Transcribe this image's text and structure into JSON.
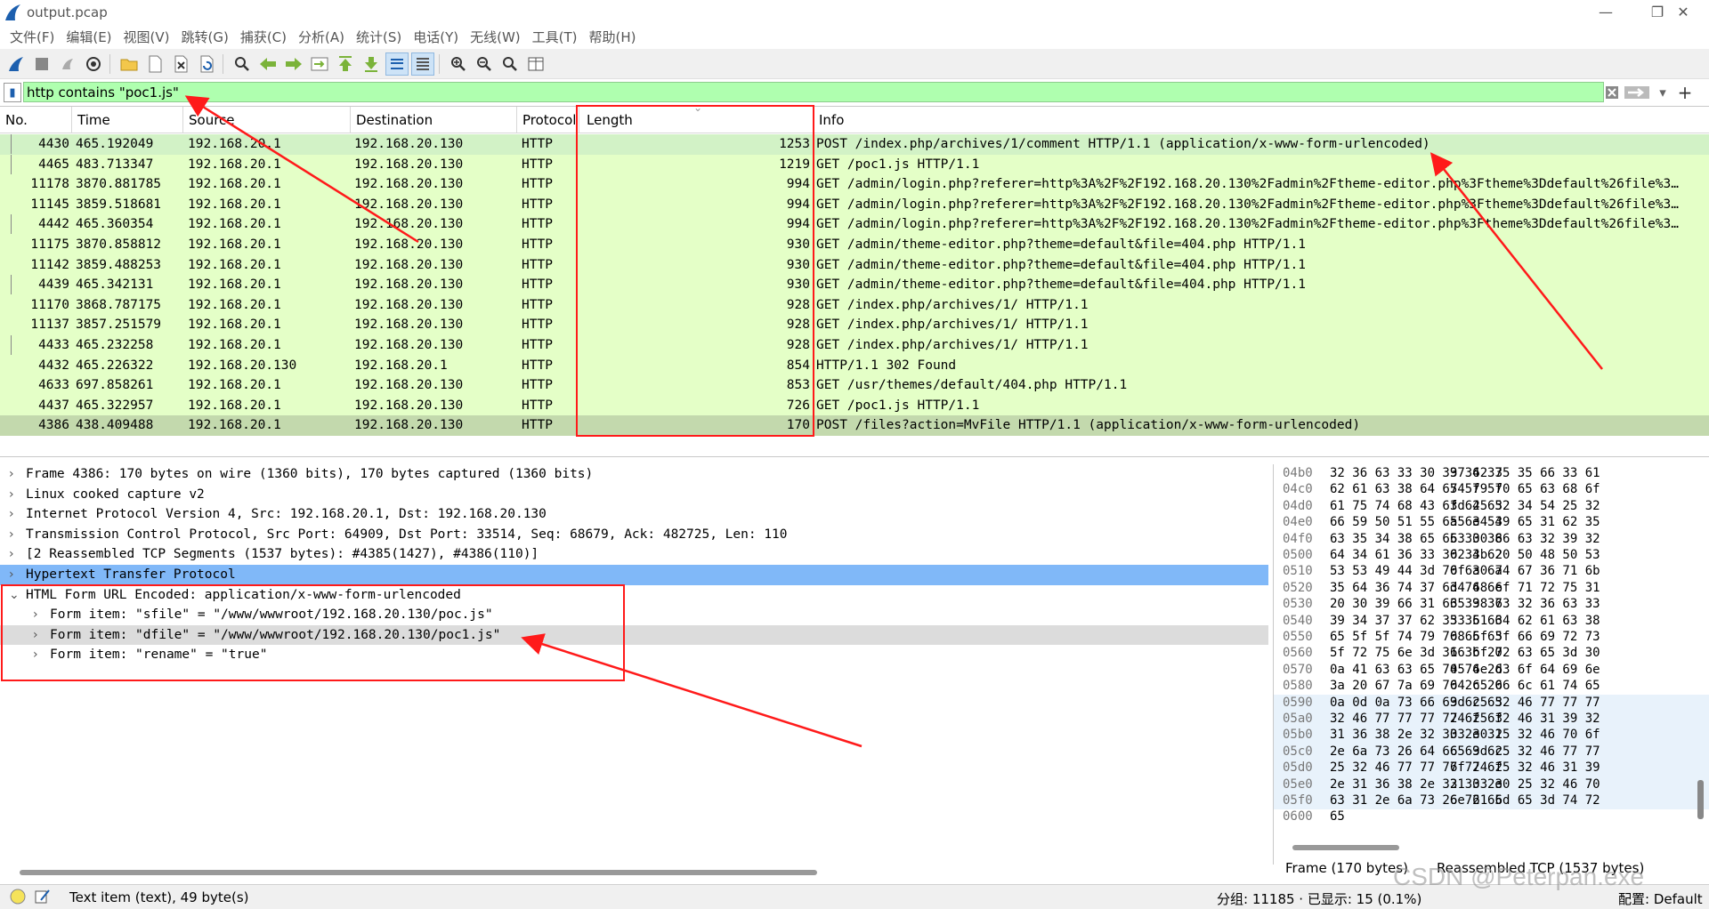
{
  "window": {
    "title": "output.pcap",
    "minimize": "—",
    "maximize": "❐",
    "close": "✕"
  },
  "menu": [
    "文件(F)",
    "编辑(E)",
    "视图(V)",
    "跳转(G)",
    "捕获(C)",
    "分析(A)",
    "统计(S)",
    "电话(Y)",
    "无线(W)",
    "工具(T)",
    "帮助(H)"
  ],
  "toolbar": {
    "icons": [
      "start-capture-icon",
      "stop-capture-icon",
      "restart-capture-icon",
      "capture-options-icon",
      "open-file-icon",
      "save-file-icon",
      "close-file-icon",
      "reload-file-icon",
      "find-packet-icon",
      "go-back-icon",
      "go-forward-icon",
      "go-to-packet-icon",
      "go-first-icon",
      "go-last-icon",
      "autoscroll-icon",
      "colorize-icon",
      "zoom-in-icon",
      "zoom-out-icon",
      "zoom-normal-icon",
      "resize-columns-icon"
    ]
  },
  "filter": {
    "value": "http contains \"poc1.js\"",
    "plus": "+"
  },
  "columns": {
    "no": "No.",
    "time": "Time",
    "source": "Source",
    "destination": "Destination",
    "protocol": "Protocol",
    "length": "Length",
    "info": "Info"
  },
  "packets": [
    {
      "no": "4430",
      "time": "465.192049",
      "src": "192.168.20.1",
      "dst": "192.168.20.130",
      "proto": "HTTP",
      "len": "1253",
      "info": "POST /index.php/archives/1/comment HTTP/1.1  (application/x-www-form-urlencoded)"
    },
    {
      "no": "4465",
      "time": "483.713347",
      "src": "192.168.20.1",
      "dst": "192.168.20.130",
      "proto": "HTTP",
      "len": "1219",
      "info": "GET /poc1.js HTTP/1.1"
    },
    {
      "no": "11178",
      "time": "3870.881785",
      "src": "192.168.20.1",
      "dst": "192.168.20.130",
      "proto": "HTTP",
      "len": "994",
      "info": "GET /admin/login.php?referer=http%3A%2F%2F192.168.20.130%2Fadmin%2Ftheme-editor.php%3Ftheme%3Ddefault%26file%3…"
    },
    {
      "no": "11145",
      "time": "3859.518681",
      "src": "192.168.20.1",
      "dst": "192.168.20.130",
      "proto": "HTTP",
      "len": "994",
      "info": "GET /admin/login.php?referer=http%3A%2F%2F192.168.20.130%2Fadmin%2Ftheme-editor.php%3Ftheme%3Ddefault%26file%3…"
    },
    {
      "no": "4442",
      "time": "465.360354",
      "src": "192.168.20.1",
      "dst": "192.168.20.130",
      "proto": "HTTP",
      "len": "994",
      "info": "GET /admin/login.php?referer=http%3A%2F%2F192.168.20.130%2Fadmin%2Ftheme-editor.php%3Ftheme%3Ddefault%26file%3…"
    },
    {
      "no": "11175",
      "time": "3870.858812",
      "src": "192.168.20.1",
      "dst": "192.168.20.130",
      "proto": "HTTP",
      "len": "930",
      "info": "GET /admin/theme-editor.php?theme=default&file=404.php HTTP/1.1"
    },
    {
      "no": "11142",
      "time": "3859.488253",
      "src": "192.168.20.1",
      "dst": "192.168.20.130",
      "proto": "HTTP",
      "len": "930",
      "info": "GET /admin/theme-editor.php?theme=default&file=404.php HTTP/1.1"
    },
    {
      "no": "4439",
      "time": "465.342131",
      "src": "192.168.20.1",
      "dst": "192.168.20.130",
      "proto": "HTTP",
      "len": "930",
      "info": "GET /admin/theme-editor.php?theme=default&file=404.php HTTP/1.1"
    },
    {
      "no": "11170",
      "time": "3868.787175",
      "src": "192.168.20.1",
      "dst": "192.168.20.130",
      "proto": "HTTP",
      "len": "928",
      "info": "GET /index.php/archives/1/ HTTP/1.1"
    },
    {
      "no": "11137",
      "time": "3857.251579",
      "src": "192.168.20.1",
      "dst": "192.168.20.130",
      "proto": "HTTP",
      "len": "928",
      "info": "GET /index.php/archives/1/ HTTP/1.1"
    },
    {
      "no": "4433",
      "time": "465.232258",
      "src": "192.168.20.1",
      "dst": "192.168.20.130",
      "proto": "HTTP",
      "len": "928",
      "info": "GET /index.php/archives/1/ HTTP/1.1"
    },
    {
      "no": "4432",
      "time": "465.226322",
      "src": "192.168.20.130",
      "dst": "192.168.20.1",
      "proto": "HTTP",
      "len": "854",
      "info": "HTTP/1.1 302 Found"
    },
    {
      "no": "4633",
      "time": "697.858261",
      "src": "192.168.20.1",
      "dst": "192.168.20.130",
      "proto": "HTTP",
      "len": "853",
      "info": "GET /usr/themes/default/404.php HTTP/1.1"
    },
    {
      "no": "4437",
      "time": "465.322957",
      "src": "192.168.20.1",
      "dst": "192.168.20.130",
      "proto": "HTTP",
      "len": "726",
      "info": "GET /poc1.js HTTP/1.1"
    },
    {
      "no": "4386",
      "time": "438.409488",
      "src": "192.168.20.1",
      "dst": "192.168.20.130",
      "proto": "HTTP",
      "len": "170",
      "info": "POST /files?action=MvFile HTTP/1.1  (application/x-www-form-urlencoded)"
    }
  ],
  "details": [
    {
      "arrow": "›",
      "text": "Frame 4386: 170 bytes on wire (1360 bits), 170 bytes captured (1360 bits)"
    },
    {
      "arrow": "›",
      "text": "Linux cooked capture v2"
    },
    {
      "arrow": "›",
      "text": "Internet Protocol Version 4, Src: 192.168.20.1, Dst: 192.168.20.130"
    },
    {
      "arrow": "›",
      "text": "Transmission Control Protocol, Src Port: 64909, Dst Port: 33514, Seq: 68679, Ack: 482725, Len: 110"
    },
    {
      "arrow": "›",
      "text": "[2 Reassembled TCP Segments (1537 bytes): #4385(1427), #4386(110)]"
    },
    {
      "arrow": "›",
      "text": "Hypertext Transfer Protocol"
    },
    {
      "arrow": "⌄",
      "text": "HTML Form URL Encoded: application/x-www-form-urlencoded"
    },
    {
      "arrow": "›",
      "text": "Form item: \"sfile\" = \"/www/wwwroot/192.168.20.130/poc.js\""
    },
    {
      "arrow": "›",
      "text": "Form item: \"dfile\" = \"/www/wwwroot/192.168.20.130/poc1.js\""
    },
    {
      "arrow": "›",
      "text": "Form item: \"rename\" = \"true\""
    }
  ],
  "hex": [
    {
      "off": "04b0",
      "b1": "32 36 63 33 30 39 34 37",
      "b2": "37 62 35 35 66 33 61"
    },
    {
      "off": "04c0",
      "b1": "62 61 63 38 64 65 5f 5f",
      "b2": "74 79 70 65 63 68 6f"
    },
    {
      "off": "04d0",
      "b1": "61 75 74 68 43 6f 64 65",
      "b2": "3d 25 32 34 54 25 32"
    },
    {
      "off": "04e0",
      "b1": "66 59 50 51 55 6a 6e 54",
      "b2": "55 34 39 65 31 62 35"
    },
    {
      "off": "04f0",
      "b1": "63 35 34 38 65 65 30 38",
      "b2": "63 30 66 63 32 39 32"
    },
    {
      "off": "0500",
      "b1": "64 34 61 36 33 30 34 62",
      "b2": "62 3b 20 50 48 50 53"
    },
    {
      "off": "0510",
      "b1": "53 53 49 44 3d 70 6a 6a",
      "b2": "6f 30 74 67 36 71 6b"
    },
    {
      "off": "0520",
      "b1": "35 64 36 74 37 6d 74 6e",
      "b2": "34 68 6f 71 72 75 31"
    },
    {
      "off": "0530",
      "b1": "20 30 39 66 31 66 39 37",
      "b2": "35 38 63 32 36 63 33"
    },
    {
      "off": "0540",
      "b1": "39 34 37 37 62 35 35 66",
      "b2": "33 61 34 62 61 63 38"
    },
    {
      "off": "0550",
      "b1": "65 5f 5f 74 79 70 65 63",
      "b2": "68 6f 5f 66 69 72 73"
    },
    {
      "off": "0560",
      "b1": "5f 72 75 6e 3d 31 3b 20",
      "b2": "66 6f 72 63 65 3d 30"
    },
    {
      "off": "0570",
      "b1": "0a 41 63 63 65 70 74 2d",
      "b2": "45 6e 63 6f 64 69 6e"
    },
    {
      "off": "0580",
      "b1": "3a 20 67 7a 69 70 2c 20",
      "b2": "64 65 66 6c 61 74 65"
    },
    {
      "off": "0590",
      "b1": "0a 0d 0a 73 66 69 6c 65",
      "b2": "3d 25 32 46 77 77 77"
    },
    {
      "off": "05a0",
      "b1": "32 46 77 77 77 72 6f 6f",
      "b2": "74 25 32 46 31 39 32"
    },
    {
      "off": "05b0",
      "b1": "31 36 38 2e 32 30 2e 31",
      "b2": "33 30 25 32 46 70 6f"
    },
    {
      "off": "05c0",
      "b1": "2e 6a 73 26 64 66 69 6c",
      "b2": "65 3d 25 32 46 77 77"
    },
    {
      "off": "05d0",
      "b1": "25 32 46 77 77 77 72 6f",
      "b2": "6f 74 25 32 46 31 39"
    },
    {
      "off": "05e0",
      "b1": "2e 31 36 38 2e 32 30 2e",
      "b2": "31 33 30 25 32 46 70"
    },
    {
      "off": "05f0",
      "b1": "63 31 2e 6a 73 26 72 65",
      "b2": "6e 61 6d 65 3d 74 72"
    },
    {
      "off": "0600",
      "b1": "65",
      "b2": ""
    }
  ],
  "hex_tabs": [
    "Frame (170 bytes)",
    "Reassembled TCP (1537 bytes)"
  ],
  "status": {
    "text_item": "Text item (text), 49 byte(s)",
    "packets": "分组: 11185 · 已显示: 15 (0.1%)",
    "profile": "配置: Default"
  },
  "watermark": "CSDN @Peterpan.exe",
  "colors": {
    "filter_bg": "#afffaf",
    "row_bg": "#e4ffc7",
    "selected_detail": "#80b8f8",
    "annotation": "#ff1a1a"
  }
}
